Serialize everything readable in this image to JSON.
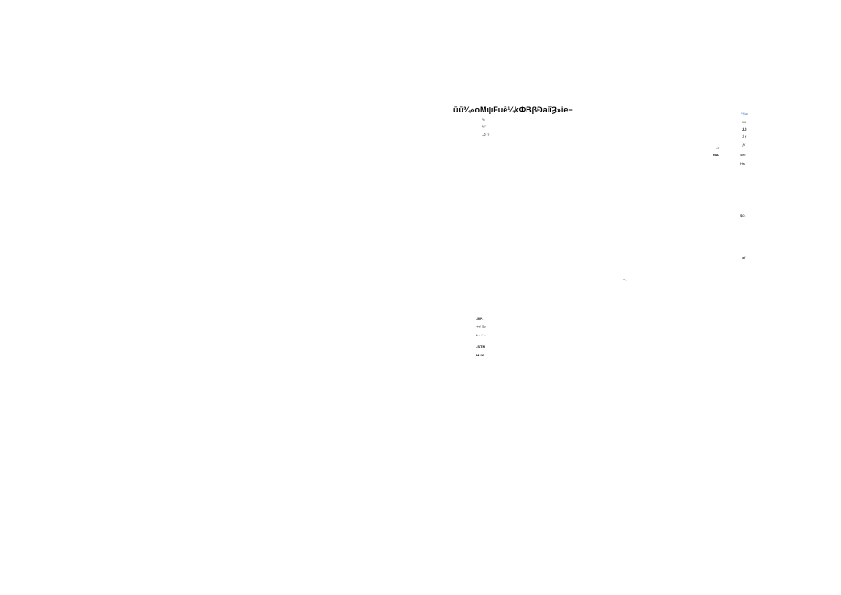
{
  "title": "ūū¾«oMψFuē¼kΦBβÐaíīȜ»ie−",
  "right_link": "*¾c",
  "right_col": {
    "r1": "~M",
    "r2": "ĴĴ",
    "r3": "Ĵ f",
    "r4": "ƒi",
    "r5": "4el",
    "r6": "Hs",
    "r7": "$0.",
    "r8": "af"
  },
  "mid_left": {
    "arrow": "->",
    "na": "NA"
  },
  "left_col": {
    "pct": "%",
    "half": "½\"",
    "plus": "₊© ?"
  },
  "tilde_dot": "~.",
  "bottom_block": {
    "l1": "-M*.",
    "l2": "+«' 5>",
    "l3": "L :  .' ::",
    "l4": "-STM",
    "l5": "M IX-"
  }
}
